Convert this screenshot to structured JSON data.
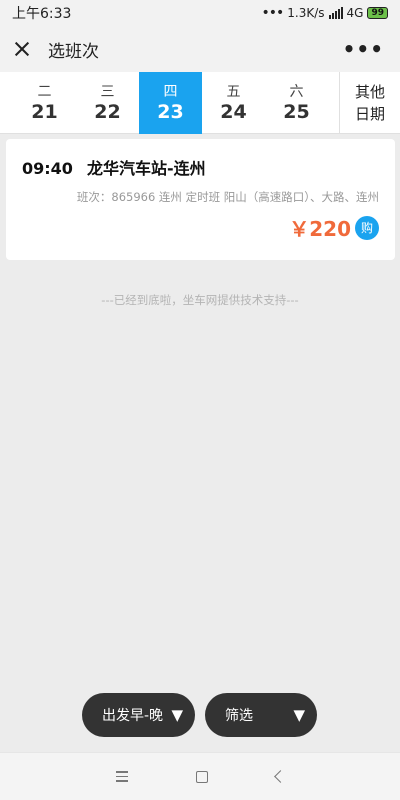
{
  "statusbar": {
    "time": "上午6:33",
    "speed": "1.3K/s",
    "network": "4G",
    "battery": "99"
  },
  "header": {
    "title": "选班次"
  },
  "dates": [
    {
      "weekday": "二",
      "day": "21",
      "active": false
    },
    {
      "weekday": "三",
      "day": "22",
      "active": false
    },
    {
      "weekday": "四",
      "day": "23",
      "active": true
    },
    {
      "weekday": "五",
      "day": "24",
      "active": false
    },
    {
      "weekday": "六",
      "day": "25",
      "active": false
    }
  ],
  "other_date": {
    "line1": "其他",
    "line2": "日期"
  },
  "trip": {
    "time": "09:40",
    "route": "龙华汽车站-连州",
    "detail": "班次：865966 连州 定时班 阳山（高速路口）、大路、连州",
    "price": "￥220",
    "buy_label": "购"
  },
  "footer_note": "---已经到底啦，坐车网提供技术支持---",
  "filters": {
    "depart_label": "出发早-晚",
    "filter_label": "筛选",
    "arrow": "▼"
  },
  "colors": {
    "accent": "#1aa3ef",
    "price": "#f06a3b"
  }
}
